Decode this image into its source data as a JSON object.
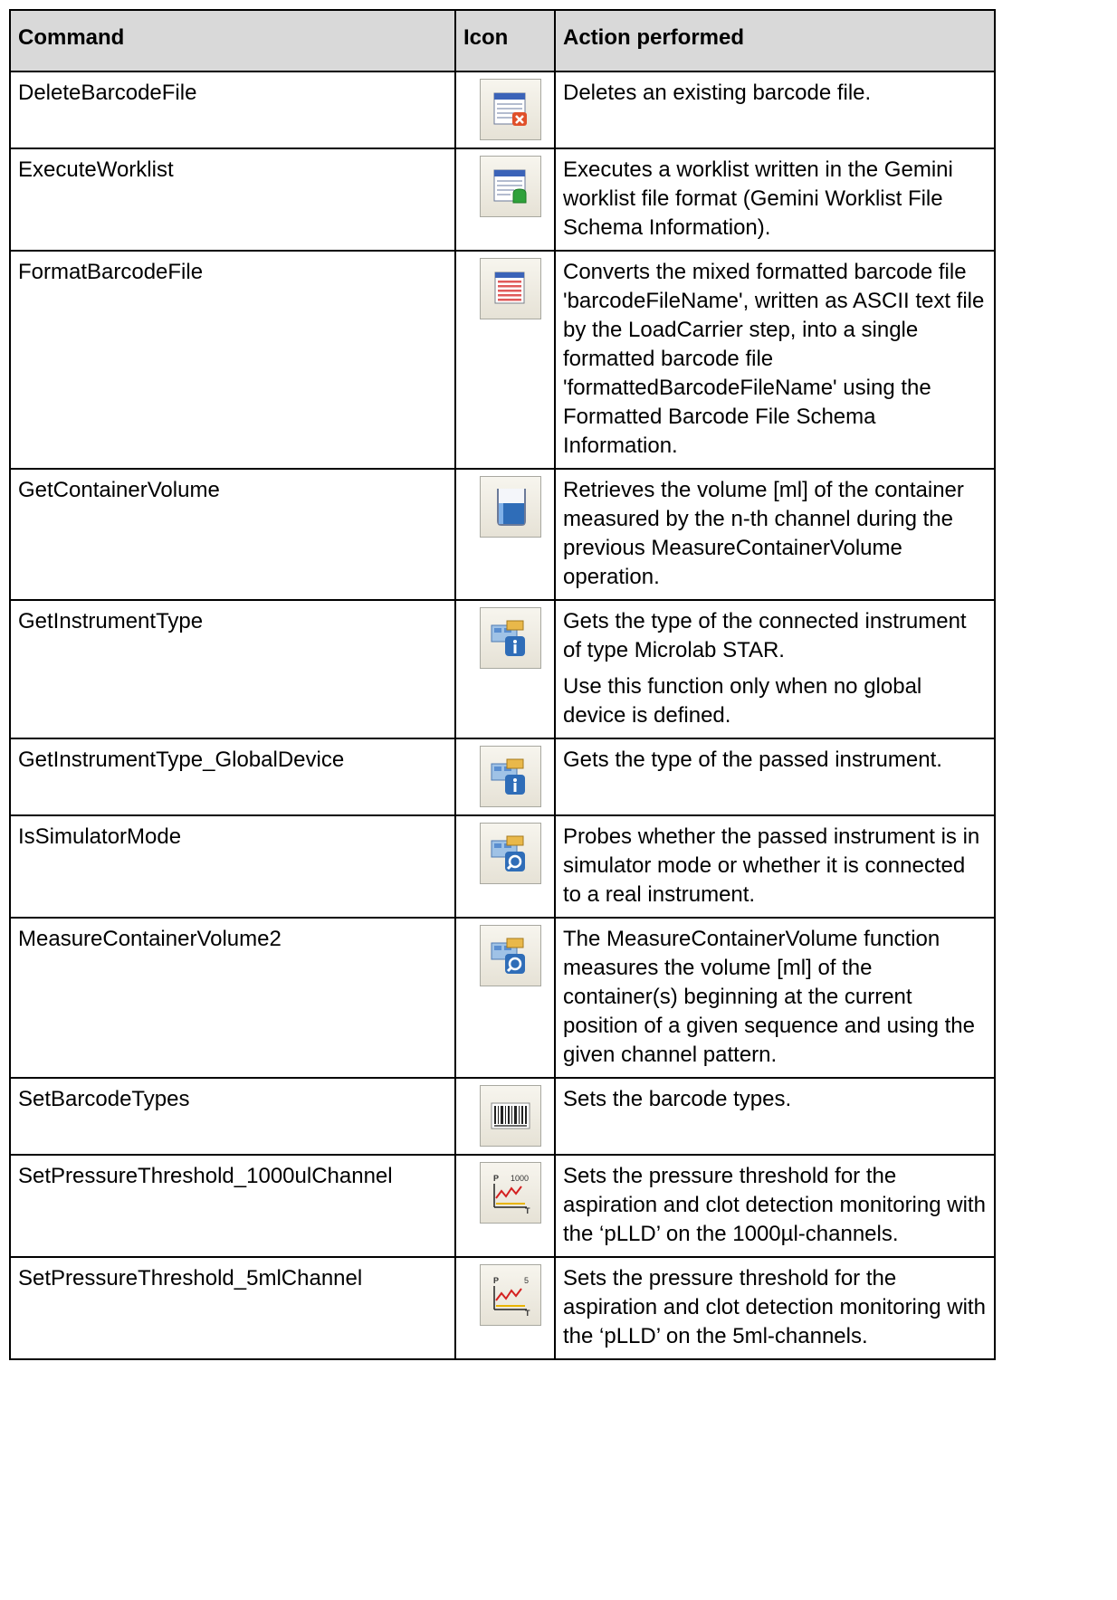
{
  "headers": {
    "command": "Command",
    "icon": "Icon",
    "action": "Action performed"
  },
  "rows": [
    {
      "command": "DeleteBarcodeFile",
      "icon": "delete-file-icon",
      "action": [
        "Deletes an existing barcode file."
      ]
    },
    {
      "command": "ExecuteWorklist",
      "icon": "execute-worklist-icon",
      "action": [
        "Executes a worklist written in the Gemini worklist file format (Gemini Worklist File Schema Information)."
      ]
    },
    {
      "command": "FormatBarcodeFile",
      "icon": "format-barcode-file-icon",
      "action": [
        "Converts the mixed formatted barcode file 'barcodeFileName', written as ASCII text file by the LoadCarrier step, into a single formatted barcode file 'formattedBarcodeFileName' using the Formatted Barcode File Schema Information."
      ]
    },
    {
      "command": "GetContainerVolume",
      "icon": "container-volume-icon",
      "action": [
        "Retrieves the volume [ml] of the container measured by the n-th channel during the previous MeasureContainerVolume operation."
      ]
    },
    {
      "command": "GetInstrumentType",
      "icon": "instrument-info-icon",
      "action": [
        "Gets the type of the connected instrument of type Microlab STAR.",
        "Use this function only when no global device is defined."
      ]
    },
    {
      "command": "GetInstrumentType_GlobalDevice",
      "icon": "instrument-info-icon",
      "action": [
        "Gets the type of the passed instrument."
      ]
    },
    {
      "command": "IsSimulatorMode",
      "icon": "instrument-tool-icon",
      "action": [
        "Probes whether the passed instrument is in simulator mode or whether it is connected to a real instrument."
      ]
    },
    {
      "command": "MeasureContainerVolume2",
      "icon": "instrument-tool-icon",
      "action": [
        "The MeasureContainerVolume function measures the volume [ml] of the container(s) beginning at the current position of a given sequence and using the given channel pattern."
      ]
    },
    {
      "command": "SetBarcodeTypes",
      "icon": "barcode-icon",
      "action": [
        "Sets the barcode types."
      ]
    },
    {
      "command": "SetPressureThreshold_1000ulChannel",
      "icon": "pressure-chart-icon",
      "icon_label": "1000",
      "action": [
        "Sets the pressure threshold for the aspiration and clot detection monitoring with the ‘pLLD’ on the 1000µl-channels."
      ]
    },
    {
      "command": "SetPressureThreshold_5mlChannel",
      "icon": "pressure-chart-icon",
      "icon_label": "5",
      "action": [
        "Sets the pressure threshold for the aspiration and clot detection monitoring with the ‘pLLD’ on the 5ml-channels."
      ]
    }
  ]
}
